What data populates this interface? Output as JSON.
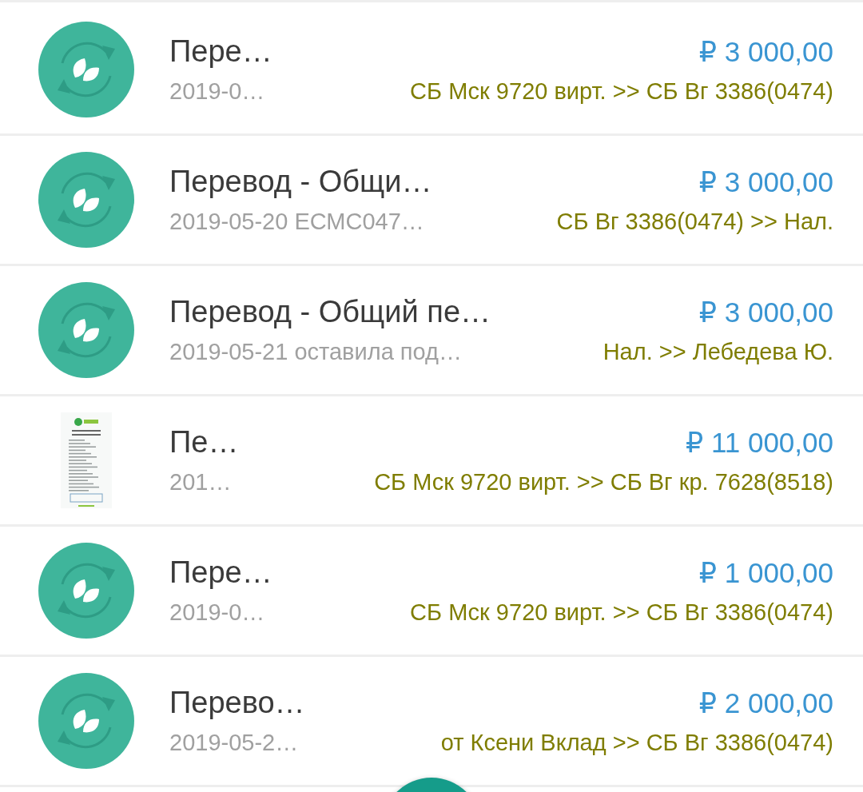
{
  "transactions": [
    {
      "kind": "transfer",
      "title": "Пере…",
      "subtitle": "2019-0…",
      "amount": "₽ 3 000,00",
      "accounts": "СБ Мск 9720 вирт. >> СБ Вг 3386(0474)"
    },
    {
      "kind": "transfer",
      "title": "Перевод - Общи…",
      "subtitle": "2019-05-20 ЕСМС047…",
      "amount": "₽ 3 000,00",
      "accounts": "СБ Вг 3386(0474) >> Нал."
    },
    {
      "kind": "transfer",
      "title": "Перевод - Общий пе…",
      "subtitle": "2019-05-21 оставила под…",
      "amount": "₽ 3 000,00",
      "accounts": "Нал. >> Лебедева Ю."
    },
    {
      "kind": "picture",
      "title": "Пе…",
      "subtitle": "201…",
      "amount": "₽ 11 000,00",
      "accounts": "СБ Мск 9720 вирт. >> СБ Вг кр. 7628(8518)"
    },
    {
      "kind": "transfer",
      "title": "Пере…",
      "subtitle": "2019-0…",
      "amount": "₽ 1 000,00",
      "accounts": "СБ Мск 9720 вирт. >> СБ Вг 3386(0474)"
    },
    {
      "kind": "transfer",
      "title": "Перево…",
      "subtitle": "2019-05-2…",
      "amount": "₽ 2 000,00",
      "accounts": "от Ксени Вклад >> СБ Вг 3386(0474)"
    }
  ]
}
